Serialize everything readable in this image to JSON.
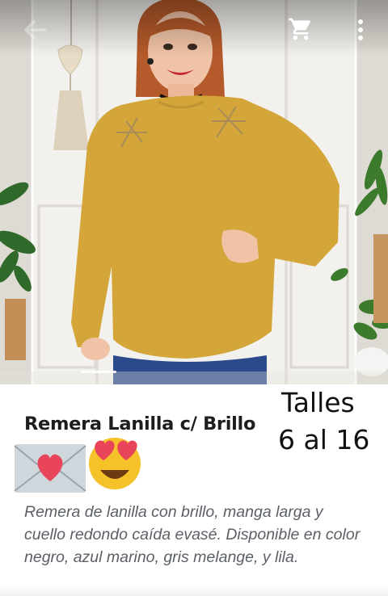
{
  "product": {
    "sizes_line1": "Talles",
    "sizes_line2": "6 al 16",
    "title": "Remera Lanilla c/ Brillo",
    "description": "Remera de lanilla con brillo, manga larga y cuello redondo caída evasé. Disponible en color negro, azul marino, gris melange, y lila.",
    "color": "#d4a63a"
  },
  "toolbar": {
    "icons": [
      "back-arrow-icon",
      "cart-icon",
      "more-vert-icon"
    ]
  },
  "emojis": [
    "love-letter-emoji",
    "heart-eyes-emoji"
  ],
  "gallery": {
    "current_slide": 1
  }
}
